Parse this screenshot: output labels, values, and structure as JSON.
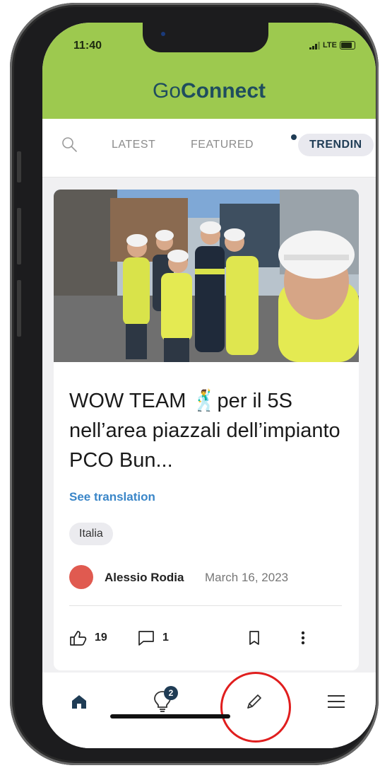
{
  "status_bar": {
    "time": "11:40",
    "network": "LTE"
  },
  "header": {
    "title_light": "Go",
    "title_bold": "Connect"
  },
  "tabs": [
    {
      "label": "LATEST"
    },
    {
      "label": "FEATURED"
    },
    {
      "label": "TRENDIN"
    }
  ],
  "post": {
    "title": "WOW TEAM 🕺per il 5S nell’area piazzali dell’impianto PCO Bun...",
    "translate_label": "See translation",
    "tag": "Italia",
    "author": "Alessio Rodia",
    "date": "March 16, 2023",
    "likes": "19",
    "comments": "1"
  },
  "nav": {
    "ideas_badge": "2"
  },
  "icons": {
    "search": "search-icon",
    "like": "thumbs-up-icon",
    "comment": "comment-icon",
    "bookmark": "bookmark-icon",
    "more": "more-vertical-icon",
    "home": "home-icon",
    "ideas": "lightbulb-icon",
    "compose": "pencil-icon",
    "menu": "hamburger-menu-icon"
  },
  "colors": {
    "header_bg": "#9dc94f",
    "brand_text": "#1f4d5e",
    "link": "#3a86c8",
    "highlight_circle": "#e01e1e"
  }
}
